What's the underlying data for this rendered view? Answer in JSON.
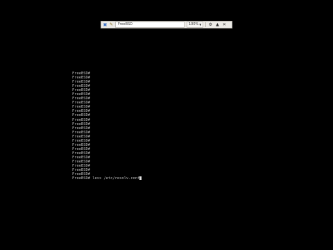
{
  "viewer": {
    "title": "FreeBSD",
    "zoom": "100%",
    "icons": [
      "app-icon",
      "pen-icon",
      "settings-icon",
      "pin-icon",
      "close-icon"
    ]
  },
  "terminal": {
    "prompt": "FreeBSD#",
    "empty_prompt_count": 25,
    "command": "less /etc/resolv.conf"
  }
}
